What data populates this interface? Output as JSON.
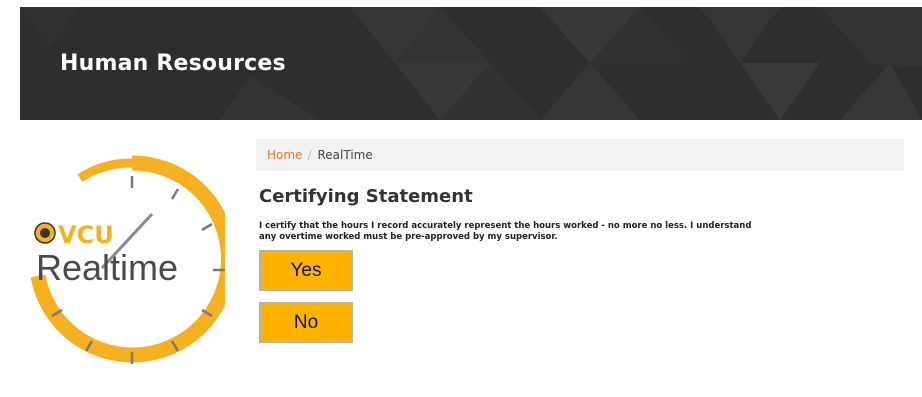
{
  "header": {
    "title": "Human Resources"
  },
  "logo": {
    "brand": "VCU",
    "product": "Realtime"
  },
  "breadcrumb": {
    "home": "Home",
    "separator": "/",
    "current": "RealTime"
  },
  "statement": {
    "title": "Certifying Statement",
    "line1": "I certify that the hours I record accurately represent the hours worked - no more no less. I understand",
    "line2": "any overtime worked must be pre-approved by my supervisor."
  },
  "buttons": {
    "yes": "Yes",
    "no": "No"
  },
  "colors": {
    "header_bg": "#2e2e2e",
    "accent_gold": "#ffb300",
    "link_orange": "#e07a1b",
    "breadcrumb_bg": "#f2f2f2"
  }
}
